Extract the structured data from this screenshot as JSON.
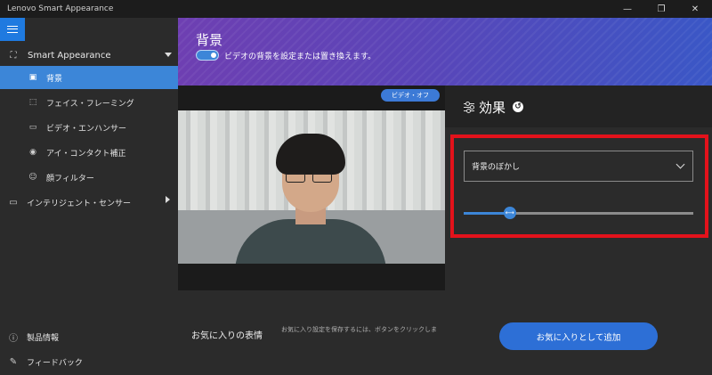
{
  "window": {
    "title": "Lenovo Smart Appearance",
    "controls": [
      "—",
      "❐",
      "✕"
    ]
  },
  "sidebar": {
    "group": {
      "label": "Smart Appearance"
    },
    "items": [
      {
        "label": "背景",
        "icon": "image-icon"
      },
      {
        "label": "フェイス・フレーミング",
        "icon": "frame-icon"
      },
      {
        "label": "ビデオ・エンハンサー",
        "icon": "monitor-icon"
      },
      {
        "label": "アイ・コンタクト補正",
        "icon": "eye-icon"
      },
      {
        "label": "顔フィルター",
        "icon": "face-filter-icon"
      }
    ],
    "group2": {
      "label": "インテリジェント・センサー"
    },
    "footer": [
      {
        "label": "製品情報",
        "icon": "info-icon"
      },
      {
        "label": "フィードバック",
        "icon": "feedback-icon"
      }
    ]
  },
  "header": {
    "title": "背景",
    "toggle_on": true,
    "description": "ビデオの背景を設定または置き換えます。"
  },
  "video": {
    "off_button": "ビデオ・オフ"
  },
  "favorites": {
    "title": "お気に入りの表情",
    "description": "お気に入り設定を保存するには、ボタンをクリックしま"
  },
  "effects": {
    "title": "効果",
    "select_value": "背景のぼかし",
    "slider_value": 0.2,
    "add_button": "お気に入りとして追加"
  },
  "colors": {
    "accent": "#3c86d8",
    "highlight": "#e3121b"
  }
}
